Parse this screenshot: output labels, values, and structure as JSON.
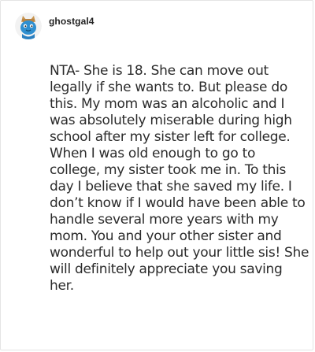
{
  "post": {
    "username": "ghostgal4",
    "avatar_icon": "ghost-cat-avatar",
    "body": "NTA- She is 18. She can move out legally if she wants to. But please do this. My mom was an alcoholic and I was absolutely miserable during high school after my sister left for college. When I was old enough to go to college, my sister took me in. To this day I believe that she saved my life. I don’t know if I would have been able to handle several more years with my mom. You and your other sister and wonderful to help out your little sis! She will definitely appreciate you saving her."
  },
  "colors": {
    "avatar_ring": "#f0f0f0",
    "avatar_body": "#2f8fd0",
    "avatar_ears": "#c8954f",
    "text": "#2b2b2b"
  }
}
